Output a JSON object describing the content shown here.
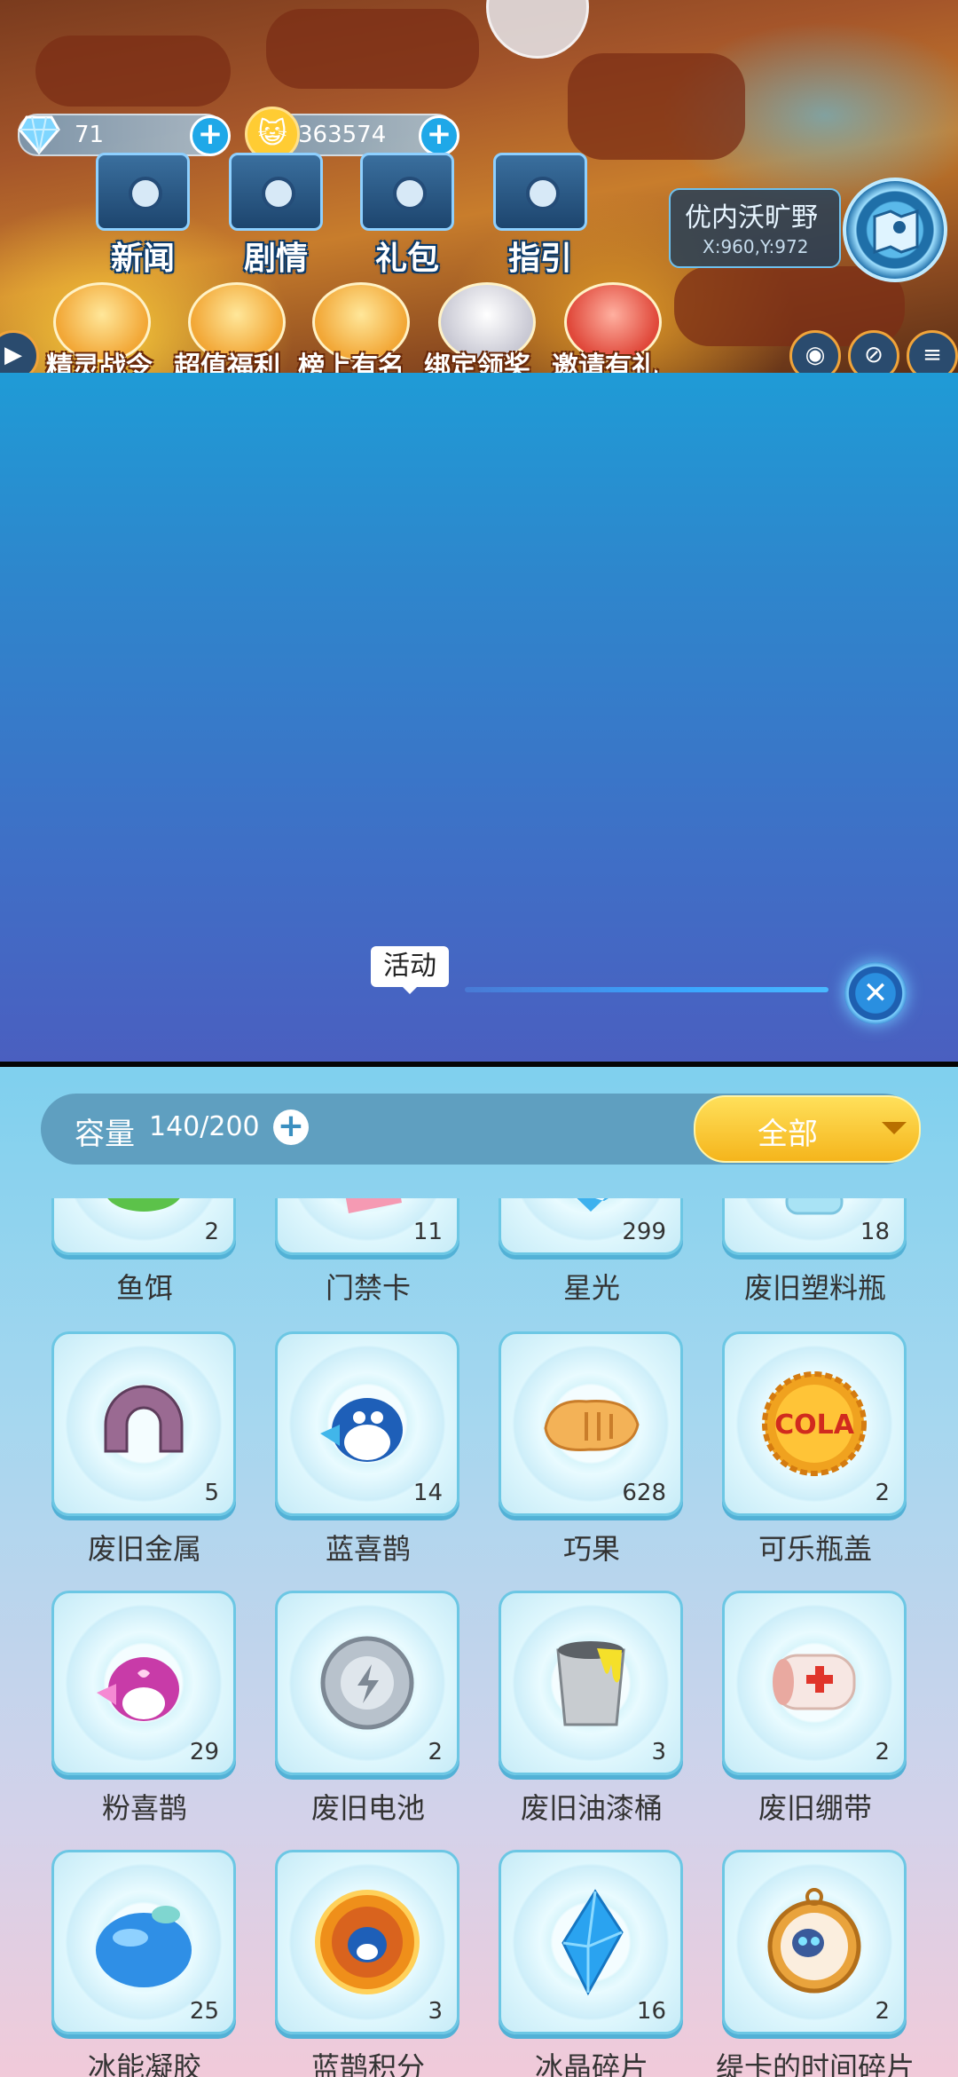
{
  "hud": {
    "diamonds": "71",
    "coins": "363574",
    "menu": [
      {
        "label": "新闻"
      },
      {
        "label": "剧情"
      },
      {
        "label": "礼包"
      },
      {
        "label": "指引"
      }
    ],
    "location": {
      "name": "优内沃旷野",
      "coords": "X:960,Y:972"
    },
    "activities": [
      {
        "label": "精灵战令"
      },
      {
        "label": "超值福利"
      },
      {
        "label": "榜上有名"
      },
      {
        "label": "绑定领奖"
      },
      {
        "label": "邀请有礼"
      }
    ]
  },
  "banner": {
    "tab_label": "活动",
    "close_symbol": "✕"
  },
  "inventory": {
    "capacity_label": "容量",
    "capacity_value": "140/200",
    "filter_label": "全部",
    "items": [
      {
        "name": "鱼饵",
        "count": "2",
        "icon": "bait-icon"
      },
      {
        "name": "门禁卡",
        "count": "11",
        "icon": "access-card-icon"
      },
      {
        "name": "星光",
        "count": "299",
        "icon": "starlight-icon"
      },
      {
        "name": "废旧塑料瓶",
        "count": "18",
        "icon": "plastic-bottle-icon"
      },
      {
        "name": "废旧金属",
        "count": "5",
        "icon": "magnet-metal-icon"
      },
      {
        "name": "蓝喜鹊",
        "count": "14",
        "icon": "blue-magpie-icon"
      },
      {
        "name": "巧果",
        "count": "628",
        "icon": "qiaoguo-cookie-icon"
      },
      {
        "name": "可乐瓶盖",
        "count": "2",
        "icon": "cola-cap-icon",
        "art_text": "COLA"
      },
      {
        "name": "粉喜鹊",
        "count": "29",
        "icon": "pink-magpie-icon"
      },
      {
        "name": "废旧电池",
        "count": "2",
        "icon": "battery-icon"
      },
      {
        "name": "废旧油漆桶",
        "count": "3",
        "icon": "paint-bucket-icon"
      },
      {
        "name": "废旧绷带",
        "count": "2",
        "icon": "bandage-icon"
      },
      {
        "name": "冰能凝胶",
        "count": "25",
        "icon": "ice-gel-icon"
      },
      {
        "name": "蓝鹊积分",
        "count": "3",
        "icon": "magpie-coin-icon"
      },
      {
        "name": "冰晶碎片",
        "count": "16",
        "icon": "ice-crystal-icon"
      },
      {
        "name": "缇卡的时间碎片",
        "count": "2",
        "icon": "pocket-watch-icon"
      }
    ]
  }
}
